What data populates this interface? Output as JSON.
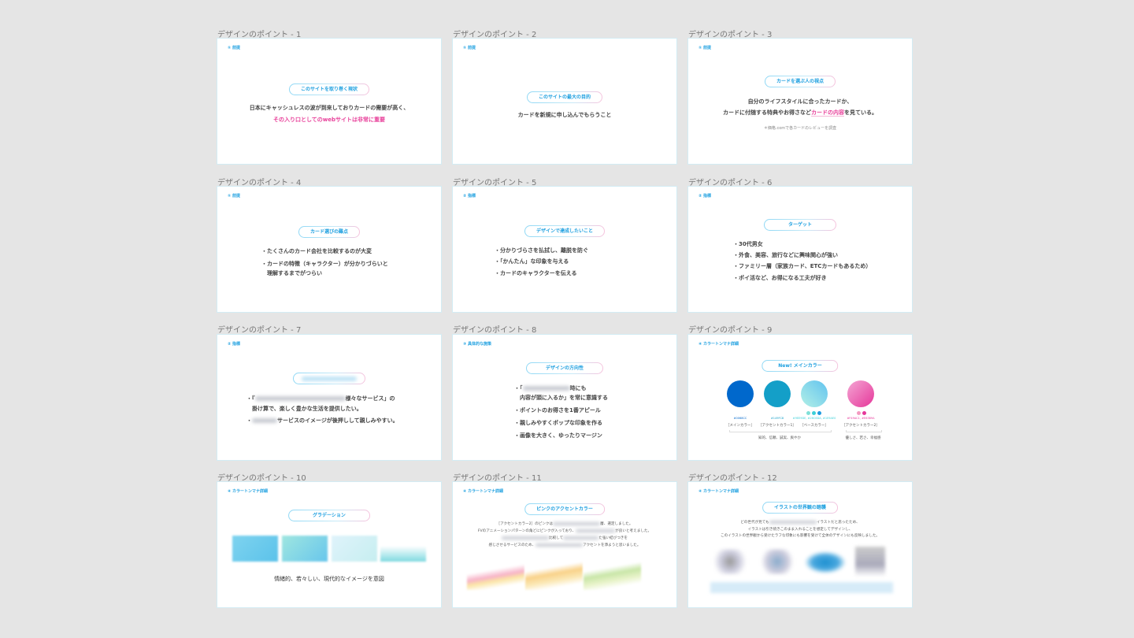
{
  "colors": {
    "accent": "#1ea0e0",
    "pink": "#e8409a",
    "canvas": "#e5e5e5"
  },
  "slides": [
    {
      "label": "デザインのポイント - 1",
      "tag": "① 前提",
      "pill": "このサイトを取り巻く現状",
      "lines": [
        "日本にキャッシュレスの波が到来しておりカードの需要が高く、",
        "その入り口としてのwebサイトは非常に重要"
      ]
    },
    {
      "label": "デザインのポイント - 2",
      "tag": "① 前提",
      "pill": "このサイトの最大の目的",
      "lines": [
        "カードを新規に申し込んでもらうこと"
      ]
    },
    {
      "label": "デザインのポイント - 3",
      "tag": "① 前提",
      "pill": "カードを選ぶ人の視点",
      "lines": [
        "自分のライフスタイルに合ったカードか、",
        "カードに付随する特典やお得さなど",
        "カードの内容",
        "を見ている。"
      ],
      "note": "＊価格.comで各カードのレビューを調査"
    },
    {
      "label": "デザインのポイント - 4",
      "tag": "① 前提",
      "pill": "カード選びの難点",
      "bullets": [
        "・たくさんのカード会社を比較するのが大変",
        "・カードの特徴（キャラクター）が分かりづらいと",
        "　理解するまでがつらい"
      ]
    },
    {
      "label": "デザインのポイント - 5",
      "tag": "② 指標",
      "pill": "デザインで達成したいこと",
      "bullets": [
        "・分かりづらさを払拭し、離脱を防ぐ",
        "・「かんたん」な印象を与える",
        "・カードのキャラクターを伝える"
      ]
    },
    {
      "label": "デザインのポイント - 6",
      "tag": "② 指標",
      "pill": "ターゲット",
      "bullets": [
        "・30代男女",
        "・外食、美容、旅行などに興味関心が強い",
        "・ファミリー層（家族カード、ETCカードもあるため）",
        "・ポイ活など、お得になる工夫が好き"
      ]
    },
    {
      "label": "デザインのポイント - 7",
      "tag": "② 指標",
      "bullets": [
        "・『",
        "様々なサービス」の",
        "　掛け算で、楽しく豊かな生活を提供したい。",
        "・",
        "サービスのイメージが後押しして親しみやすい。"
      ]
    },
    {
      "label": "デザインのポイント - 8",
      "tag": "③ 具体的な施策",
      "pill": "デザインの方向性",
      "bullets": [
        "・「",
        "時にも",
        "　内容が頭に入るか」を常に意識する",
        "・ポイントのお得さを1番アピール",
        "・親しみやすくポップな印象を作る",
        "・画像を大きく、ゆったりマージン"
      ]
    },
    {
      "label": "デザインのポイント - 9",
      "tag": "④ カラートンマナ詳細",
      "pill": "New! メインカラー",
      "swatches": [
        {
          "color": "#0068cc",
          "hex": "#0068CC",
          "name": "［メインカラー］"
        },
        {
          "color": "#149fc8",
          "hex": "#149FC8",
          "name": "［アクセントカラー1］"
        },
        {
          "color": "linear-gradient(45deg,#b3f0e6,#62c3ef)",
          "hex": "#9EE9DE, #26C6DA, #1E9AE0",
          "name": "［ベースカラー］",
          "dots": [
            "#7fe0d8",
            "#3ccfd8",
            "#1e9ae0"
          ]
        },
        {
          "color": "linear-gradient(45deg,#f4a6d4,#e6379a)",
          "hex": "#F49AC1, #E6389A",
          "name": "［アクセントカラー2］",
          "dots": [
            "#f49ac1",
            "#e6389a"
          ]
        }
      ],
      "desc_main": "知的、信頼、誠実、爽やか",
      "desc_accent": "優しさ、若さ、幸福感"
    },
    {
      "label": "デザインのポイント - 10",
      "tag": "④ カラートンマナ詳細",
      "pill": "グラデーション",
      "caption": "情緒的、若々しい、現代的なイメージを意図"
    },
    {
      "label": "デザインのポイント - 11",
      "tag": "④ カラートンマナ詳細",
      "pill": "ピンクのアクセントカラー",
      "para": [
        "［アクセントカラー2］のピンクは",
        "層、選定しました。",
        "FVのアニメーションパターンの角どにピンクが入っており、",
        "が良いと考えました。",
        "比較して",
        "た強い結びつきを",
        "感じさせるサービスのため、",
        "アクセントを添ようと思いました。"
      ]
    },
    {
      "label": "デザインのポイント - 12",
      "tag": "④ カラートンマナ詳細",
      "pill": "イラストの世界観の踏襲",
      "para": [
        "どの世代が見ても",
        "イラストだと思ったため、",
        "イラストは引き続きこのまま入れることを想定してデザインし、",
        "このイラストの世界観から受けたラフな印象にも影響を受けて全体のデザインにも反映しました。"
      ]
    }
  ]
}
